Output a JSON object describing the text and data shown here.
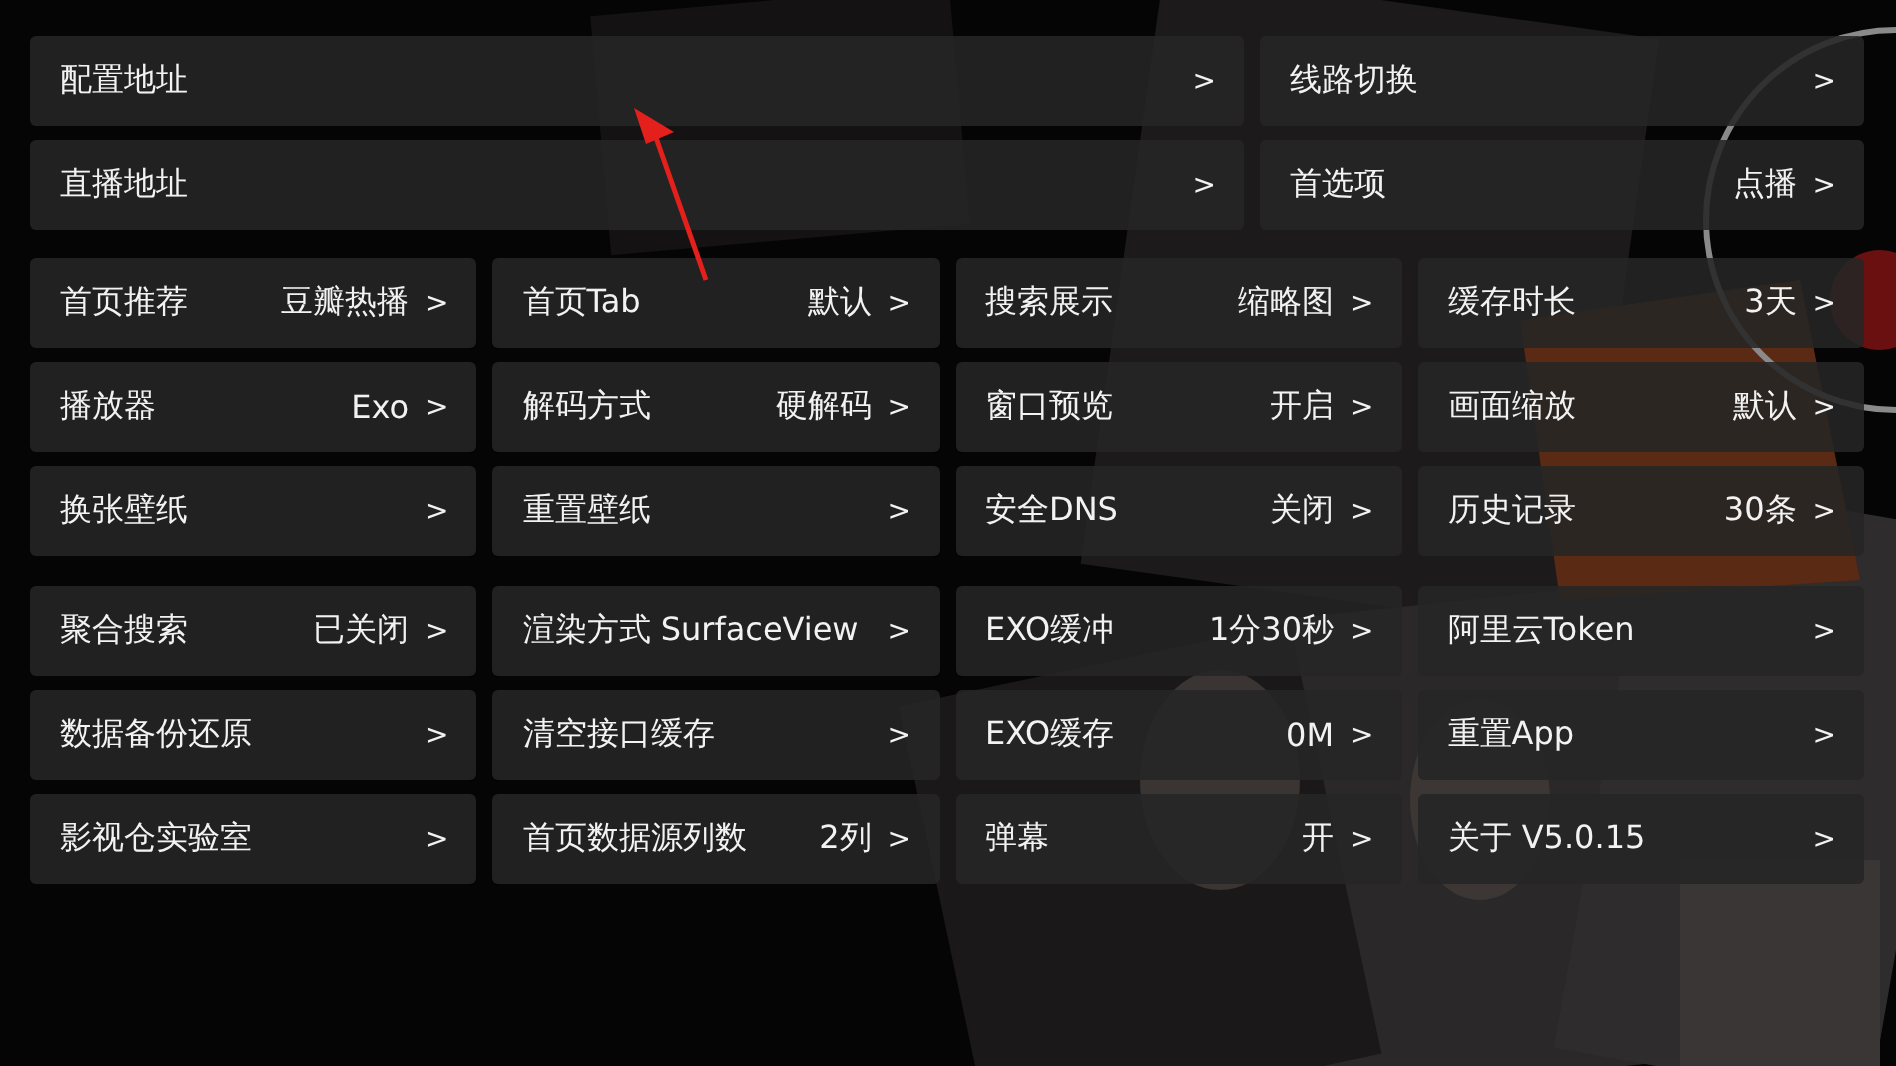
{
  "top_rows": [
    {
      "items": [
        {
          "label": "配置地址",
          "arrow": ">"
        },
        {
          "label": "线路切换",
          "arrow": ">"
        }
      ]
    },
    {
      "items": [
        {
          "label": "直播地址",
          "arrow": ">"
        },
        {
          "label": "首选项",
          "value": "点播",
          "arrow": ">"
        }
      ]
    }
  ],
  "grid_groups": [
    {
      "rows": [
        {
          "items": [
            {
              "label": "首页推荐",
              "value": "豆瓣热播",
              "arrow": ">"
            },
            {
              "label": "首页Tab",
              "value": "默认",
              "arrow": ">"
            },
            {
              "label": "搜索展示",
              "value": "缩略图",
              "arrow": ">"
            },
            {
              "label": "缓存时长",
              "value": "3天",
              "arrow": ">"
            }
          ]
        },
        {
          "items": [
            {
              "label": "播放器",
              "value": "Exo",
              "arrow": ">"
            },
            {
              "label": "解码方式",
              "value": "硬解码",
              "arrow": ">"
            },
            {
              "label": "窗口预览",
              "value": "开启",
              "arrow": ">"
            },
            {
              "label": "画面缩放",
              "value": "默认",
              "arrow": ">"
            }
          ]
        },
        {
          "items": [
            {
              "label": "换张壁纸",
              "arrow": ">"
            },
            {
              "label": "重置壁纸",
              "arrow": ">"
            },
            {
              "label": "安全DNS",
              "value": "关闭",
              "arrow": ">"
            },
            {
              "label": "历史记录",
              "value": "30条",
              "arrow": ">"
            }
          ]
        }
      ]
    },
    {
      "rows": [
        {
          "items": [
            {
              "label": "聚合搜索",
              "value": "已关闭",
              "arrow": ">"
            },
            {
              "label": "渲染方式 SurfaceView",
              "arrow": ">"
            },
            {
              "label": "EXO缓冲",
              "value": "1分30秒",
              "arrow": ">"
            },
            {
              "label": "阿里云Token",
              "arrow": ">"
            }
          ]
        },
        {
          "items": [
            {
              "label": "数据备份还原",
              "arrow": ">"
            },
            {
              "label": "清空接口缓存",
              "arrow": ">"
            },
            {
              "label": "EXO缓存",
              "value": "0M",
              "arrow": ">"
            },
            {
              "label": "重置App",
              "arrow": ">"
            }
          ]
        },
        {
          "items": [
            {
              "label": "影视仓实验室",
              "arrow": ">"
            },
            {
              "label": "首页数据源列数",
              "value": "2列",
              "arrow": ">"
            },
            {
              "label": "弹幕",
              "value": "开",
              "arrow": ">"
            },
            {
              "label": "关于  V5.0.15",
              "arrow": ">"
            }
          ]
        }
      ]
    }
  ]
}
